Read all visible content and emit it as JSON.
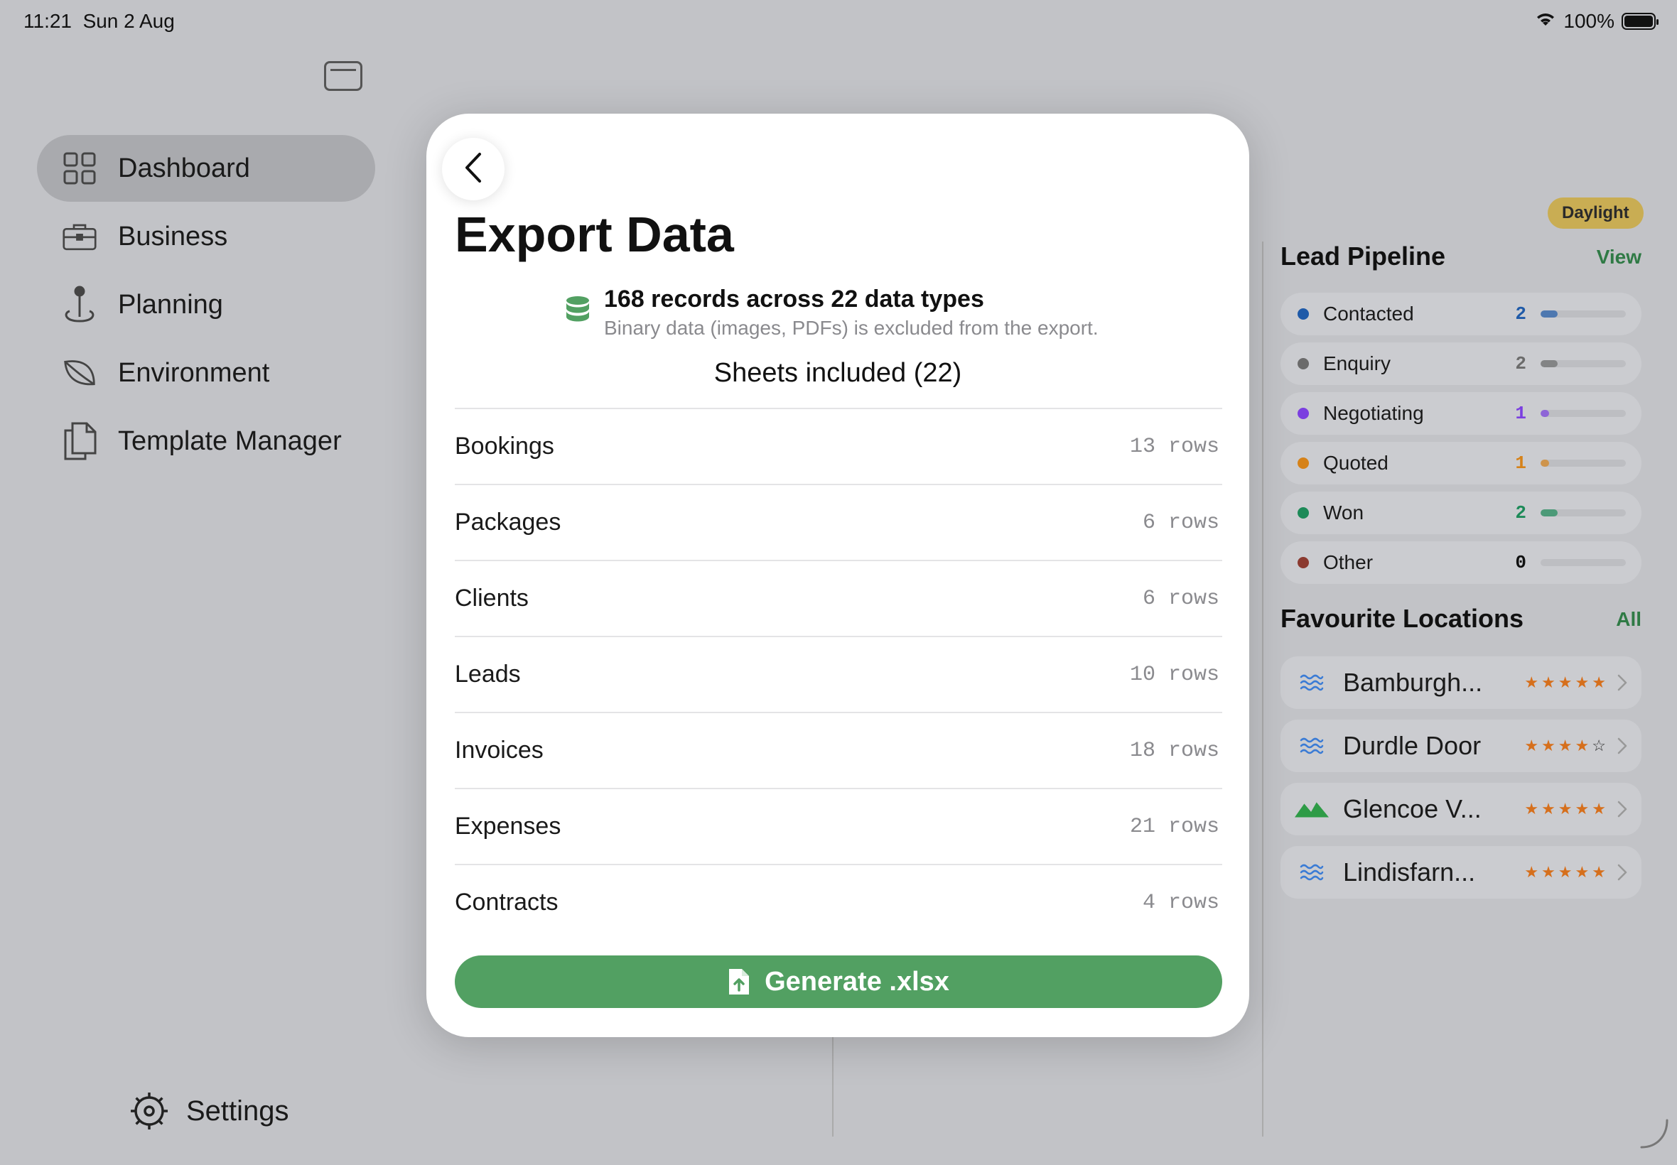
{
  "status_bar": {
    "time": "11:21",
    "date": "Sun 2 Aug",
    "battery": "100%"
  },
  "sidebar": {
    "items": [
      {
        "label": "Dashboard",
        "icon": "grid-icon",
        "active": true
      },
      {
        "label": "Business",
        "icon": "briefcase-icon"
      },
      {
        "label": "Planning",
        "icon": "pin-icon"
      },
      {
        "label": "Environment",
        "icon": "leaf-icon"
      },
      {
        "label": "Template Manager",
        "icon": "documents-icon"
      }
    ],
    "settings_label": "Settings"
  },
  "right_panel": {
    "badge": "Daylight",
    "pipeline": {
      "title": "Lead Pipeline",
      "link": "View",
      "rows": [
        {
          "label": "Contacted",
          "count": "2",
          "color": "#1f5aa8",
          "fill": 0.2
        },
        {
          "label": "Enquiry",
          "count": "2",
          "color": "#6b6b6b",
          "fill": 0.2
        },
        {
          "label": "Negotiating",
          "count": "1",
          "color": "#7b3fe0",
          "fill": 0.1
        },
        {
          "label": "Quoted",
          "count": "1",
          "color": "#d68219",
          "fill": 0.1
        },
        {
          "label": "Won",
          "count": "2",
          "color": "#1d8a58",
          "fill": 0.2
        },
        {
          "label": "Other",
          "count": "0",
          "color": "#8b3a30",
          "fill": 0
        }
      ]
    },
    "locations": {
      "title": "Favourite Locations",
      "link": "All",
      "rows": [
        {
          "name": "Bamburgh...",
          "icon": "waves-icon",
          "rating": 5
        },
        {
          "name": "Durdle Door",
          "icon": "waves-icon",
          "rating": 4
        },
        {
          "name": "Glencoe V...",
          "icon": "mountains-icon",
          "rating": 5
        },
        {
          "name": "Lindisfarn...",
          "icon": "waves-icon",
          "rating": 5
        }
      ]
    }
  },
  "modal": {
    "title": "Export Data",
    "summary": "168 records across 22 data types",
    "note": "Binary data (images, PDFs) is excluded from the export.",
    "sheets_header": "Sheets included (22)",
    "sheets": [
      {
        "name": "Bookings",
        "rows": "13 rows"
      },
      {
        "name": "Packages",
        "rows": "6 rows"
      },
      {
        "name": "Clients",
        "rows": "6 rows"
      },
      {
        "name": "Leads",
        "rows": "10 rows"
      },
      {
        "name": "Invoices",
        "rows": "18 rows"
      },
      {
        "name": "Expenses",
        "rows": "21 rows"
      },
      {
        "name": "Contracts",
        "rows": "4 rows"
      }
    ],
    "generate_label": "Generate .xlsx"
  },
  "colors": {
    "accent_green": "#52a062",
    "link_green": "#2f7a45",
    "badge_yellow": "#c9ad53",
    "star_orange": "#d66f1c"
  }
}
